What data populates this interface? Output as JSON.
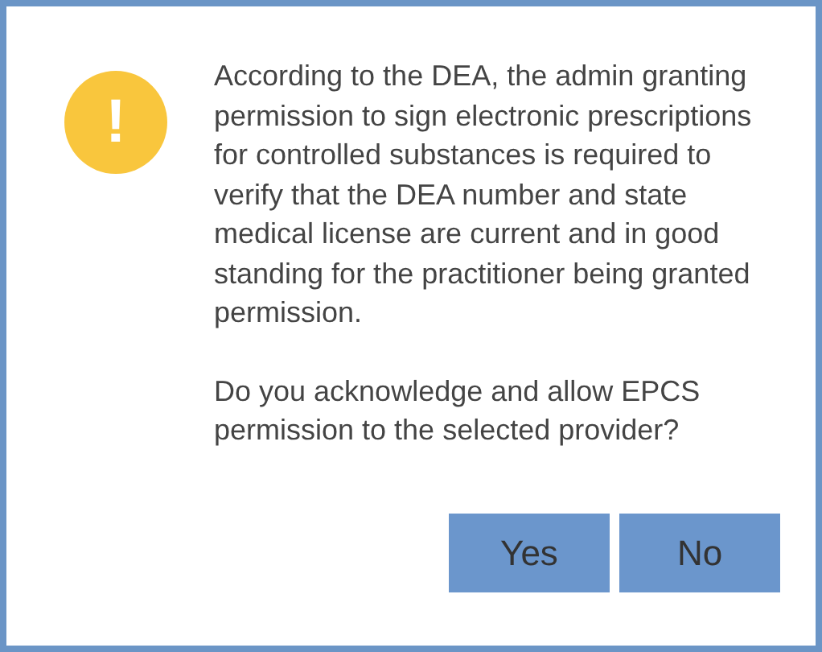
{
  "dialog": {
    "icon": "!",
    "paragraphs": [
      "According to the DEA, the admin granting permission to sign electronic prescriptions for controlled substances is required to verify that the DEA number and state medical license are current and in good standing for the practitioner being granted permission.",
      "Do you acknowledge and allow EPCS permission to the selected provider?"
    ],
    "buttons": [
      "Yes",
      "No"
    ]
  }
}
